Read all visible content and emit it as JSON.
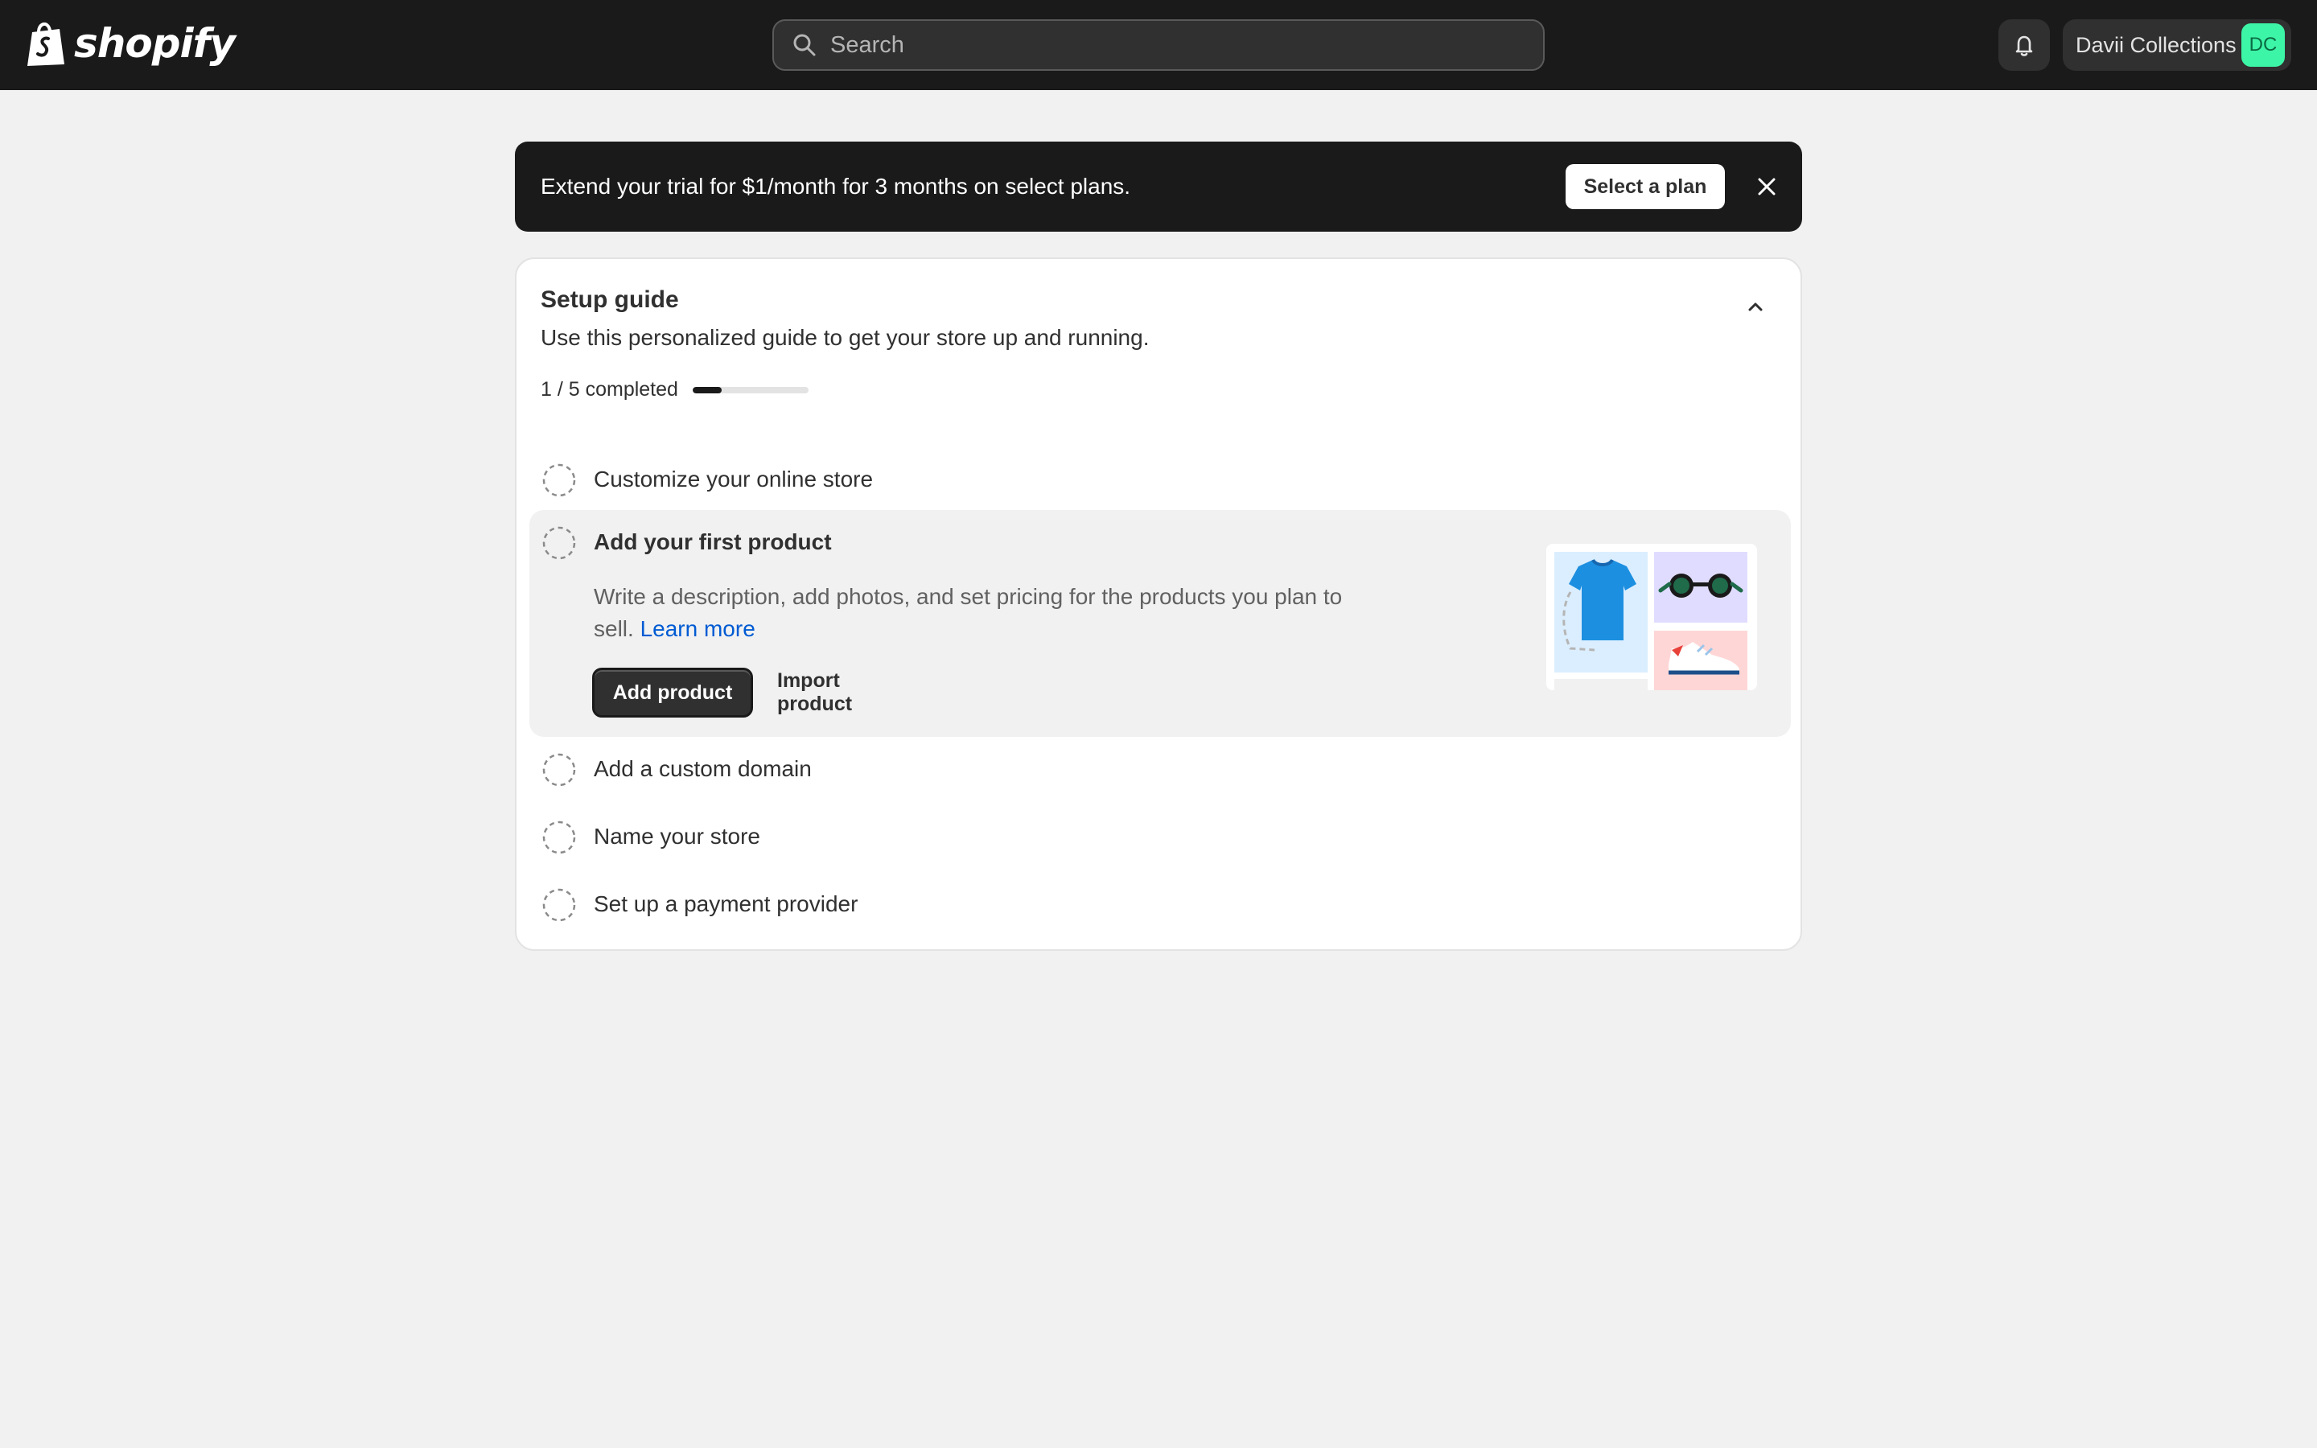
{
  "topbar": {
    "logo_text": "shopify",
    "search": {
      "placeholder": "Search"
    },
    "store": {
      "name": "Davii Collections",
      "initials": "DC"
    }
  },
  "banner": {
    "text": "Extend your trial for $1/month for 3 months on select plans.",
    "button_label": "Select a plan"
  },
  "setup_guide": {
    "title": "Setup guide",
    "subtitle": "Use this personalized guide to get your store up and running.",
    "progress_text": "1 / 5 completed",
    "progress_fraction": 0.25,
    "tasks": [
      {
        "label": "Customize your online store"
      },
      {
        "label": "Add your first product",
        "description": "Write a description, add photos, and set pricing for the products you plan to sell.",
        "link_text": "Learn more",
        "primary_button": "Add product",
        "secondary_button": "Import product"
      },
      {
        "label": "Add a custom domain"
      },
      {
        "label": "Name your store"
      },
      {
        "label": "Set up a payment provider"
      }
    ]
  },
  "colors": {
    "topbar_bg": "#1a1a1a",
    "page_bg": "#f1f1f1",
    "avatar_bg": "#3df5a6",
    "link": "#005bd3"
  },
  "icons": {
    "search": "search-icon",
    "bell": "bell-icon",
    "close": "close-icon",
    "collapse": "chevron-up-icon",
    "task_status": "dashed-circle-icon"
  }
}
